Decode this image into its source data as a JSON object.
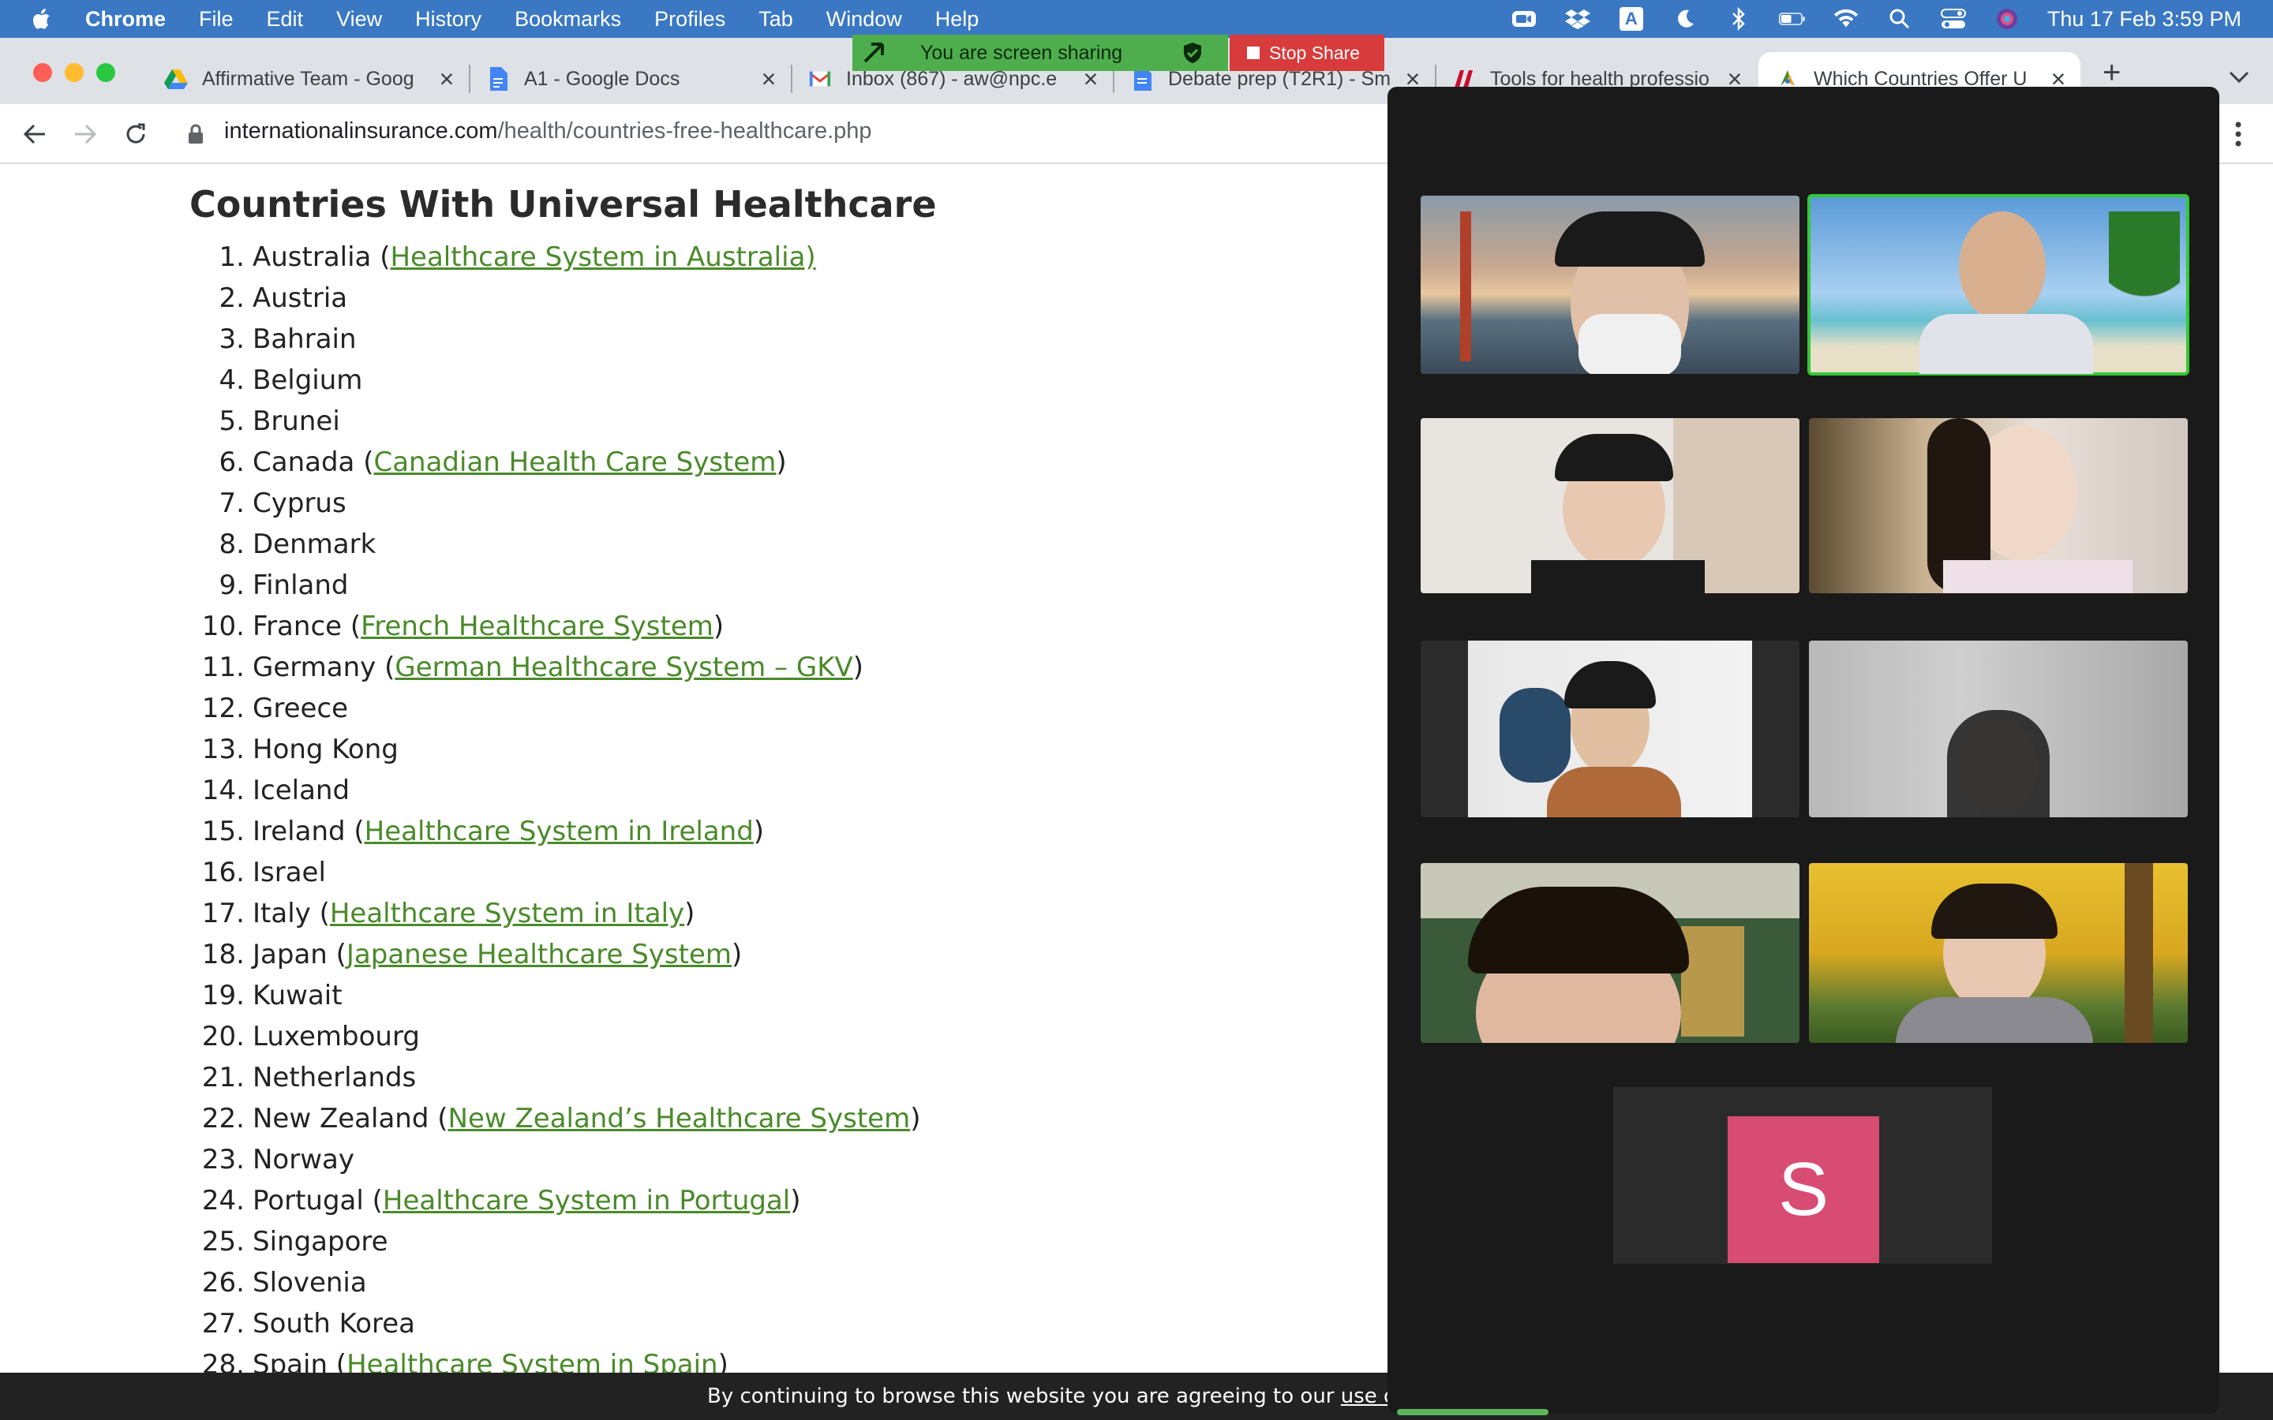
{
  "menubar": {
    "app": "Chrome",
    "items": [
      "File",
      "Edit",
      "View",
      "History",
      "Bookmarks",
      "Profiles",
      "Tab",
      "Window",
      "Help"
    ],
    "datetime": "Thu 17 Feb  3:59 PM",
    "status_icons": [
      "zoom-icon",
      "dropbox-icon",
      "input-source-icon",
      "moon-icon",
      "bluetooth-icon",
      "battery-icon",
      "wifi-icon",
      "spotlight-icon",
      "control-center-icon",
      "siri-icon"
    ],
    "input_source_label": "A"
  },
  "tabs": [
    {
      "title": "Affirmative Team - Goog",
      "favicon": "google-drive-icon"
    },
    {
      "title": "A1 - Google Docs",
      "favicon": "google-docs-icon"
    },
    {
      "title": "Inbox (867) - aw@npc.e",
      "favicon": "gmail-icon"
    },
    {
      "title": "Debate prep (T2R1) - Sm",
      "favicon": "google-docs-icon"
    },
    {
      "title": "Tools for health professio",
      "favicon": "health-icon"
    },
    {
      "title": "Which Countries Offer U",
      "favicon": "site-icon"
    }
  ],
  "new_tab_label": "+",
  "share": {
    "text": "You are screen sharing",
    "stop_label": "Stop Share"
  },
  "address": {
    "domain": "internationalinsurance.com",
    "path": "/health/countries-free-healthcare.php"
  },
  "page": {
    "title": "Countries With Universal Healthcare",
    "countries": [
      {
        "num": "1.",
        "name": "Australia",
        "link": "Healthcare System in Australia)"
      },
      {
        "num": "2.",
        "name": "Austria",
        "link": ""
      },
      {
        "num": "3.",
        "name": "Bahrain",
        "link": ""
      },
      {
        "num": "4.",
        "name": "Belgium",
        "link": ""
      },
      {
        "num": "5.",
        "name": "Brunei",
        "link": ""
      },
      {
        "num": "6.",
        "name": "Canada",
        "link": "Canadian Health Care System"
      },
      {
        "num": "7.",
        "name": "Cyprus",
        "link": ""
      },
      {
        "num": "8.",
        "name": "Denmark",
        "link": ""
      },
      {
        "num": "9.",
        "name": "Finland",
        "link": ""
      },
      {
        "num": "10.",
        "name": "France",
        "link": "French Healthcare System"
      },
      {
        "num": "11.",
        "name": "Germany",
        "link": "German Healthcare System – GKV"
      },
      {
        "num": "12.",
        "name": "Greece",
        "link": ""
      },
      {
        "num": "13.",
        "name": "Hong Kong",
        "link": ""
      },
      {
        "num": "14.",
        "name": "Iceland",
        "link": ""
      },
      {
        "num": "15.",
        "name": "Ireland",
        "link": "Healthcare System in Ireland"
      },
      {
        "num": "16.",
        "name": "Israel",
        "link": ""
      },
      {
        "num": "17.",
        "name": "Italy",
        "link": "Healthcare System in Italy"
      },
      {
        "num": "18.",
        "name": "Japan",
        "link": "Japanese Healthcare System"
      },
      {
        "num": "19.",
        "name": "Kuwait",
        "link": ""
      },
      {
        "num": "20.",
        "name": "Luxembourg",
        "link": ""
      },
      {
        "num": "21.",
        "name": "Netherlands",
        "link": ""
      },
      {
        "num": "22.",
        "name": "New Zealand",
        "link": "New Zealand’s Healthcare System"
      },
      {
        "num": "23.",
        "name": "Norway",
        "link": ""
      },
      {
        "num": "24.",
        "name": "Portugal",
        "link": "Healthcare System in Portugal"
      },
      {
        "num": "25.",
        "name": "Singapore",
        "link": ""
      },
      {
        "num": "26.",
        "name": "Slovenia",
        "link": ""
      },
      {
        "num": "27.",
        "name": "South Korea",
        "link": ""
      },
      {
        "num": "28.",
        "name": "Spain",
        "link": "Healthcare System in Spain"
      }
    ]
  },
  "cookie": {
    "text": "By continuing to browse this website you are agreeing to our ",
    "link": "use of cookies",
    "end": "."
  },
  "zoom": {
    "avatar_letter": "S",
    "colors": {
      "speaking_border": "#35c935",
      "avatar_bg": "#d84b73"
    }
  },
  "colors": {
    "menubar": "#3a78c3",
    "link": "#4a8a2a",
    "share_banner": "#4eae4e",
    "stop_share": "#d83b3b"
  }
}
